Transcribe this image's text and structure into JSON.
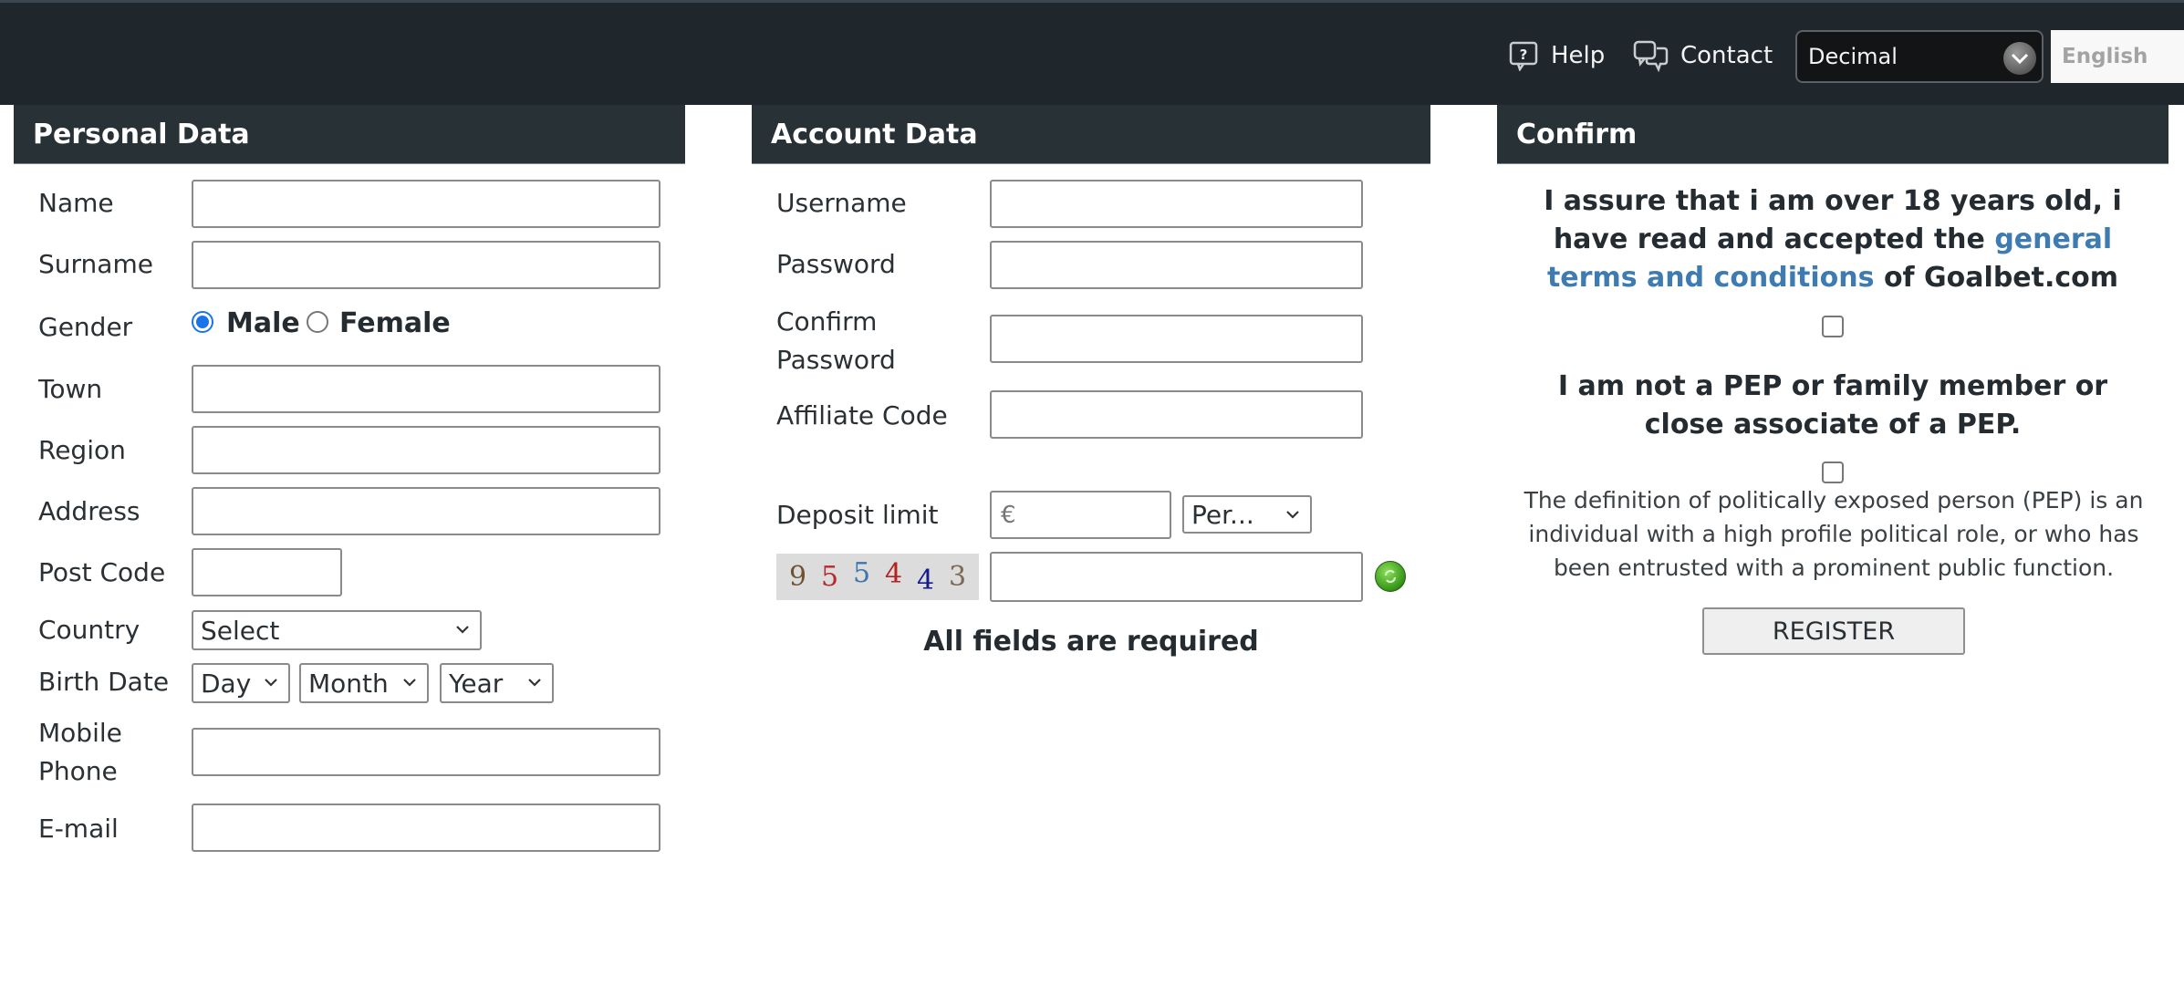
{
  "topbar": {
    "help_label": "Help",
    "contact_label": "Contact",
    "odds_format": "Decimal",
    "language": "English"
  },
  "personal": {
    "title": "Personal Data",
    "labels": {
      "name": "Name",
      "surname": "Surname",
      "gender": "Gender",
      "town": "Town",
      "region": "Region",
      "address": "Address",
      "post_code": "Post Code",
      "country": "Country",
      "birth_date": "Birth Date",
      "mobile_line1": "Mobile",
      "mobile_line2": "Phone",
      "email": "E-mail"
    },
    "values": {
      "name": "",
      "surname": "",
      "town": "",
      "region": "",
      "address": "",
      "post_code": "",
      "mobile": "",
      "email": ""
    },
    "gender_options": [
      {
        "label": "Male",
        "selected": true
      },
      {
        "label": "Female",
        "selected": false
      }
    ],
    "country_selected": "Select",
    "birth_day": "Day",
    "birth_month": "Month",
    "birth_year": "Year"
  },
  "account": {
    "title": "Account Data",
    "labels": {
      "username": "Username",
      "password": "Password",
      "confirm_line1": "Confirm",
      "confirm_line2": "Password",
      "affiliate": "Affiliate Code",
      "deposit": "Deposit limit"
    },
    "values": {
      "username": "",
      "password": "",
      "confirm_password": "",
      "affiliate": "",
      "deposit": "",
      "captcha": ""
    },
    "deposit_placeholder": "€",
    "deposit_period": "Per...",
    "captcha_digits": [
      "9",
      "5",
      "5",
      "4",
      "4",
      "3"
    ],
    "required_note": "All fields are required"
  },
  "confirm": {
    "title": "Confirm",
    "age_text_before": "I assure that i am over 18 years old, i have read and accepted the ",
    "terms_link": "general terms and conditions",
    "age_text_after": " of Goalbet.com",
    "age_checked": false,
    "pep_statement": "I am not a PEP or family member or close associate of a PEP.",
    "pep_checked": false,
    "pep_definition": "The definition of politically exposed person (PEP) is an individual with a high profile political role, or who has been entrusted with a prominent public function.",
    "register_label": "REGISTER"
  },
  "colors": {
    "topbar": "#1f262c",
    "panel_header": "#283136",
    "link": "#3d7bb0",
    "radio_selected": "#1a73e8"
  }
}
